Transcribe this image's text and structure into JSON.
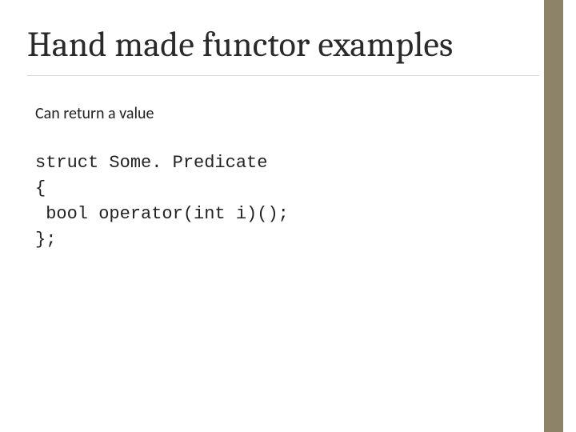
{
  "slide": {
    "title": "Hand made functor examples",
    "subtitle": "Can return a value",
    "code": {
      "line1": "struct Some. Predicate",
      "line2": "{",
      "line3": " bool operator(int i)();",
      "line4": "};"
    }
  }
}
